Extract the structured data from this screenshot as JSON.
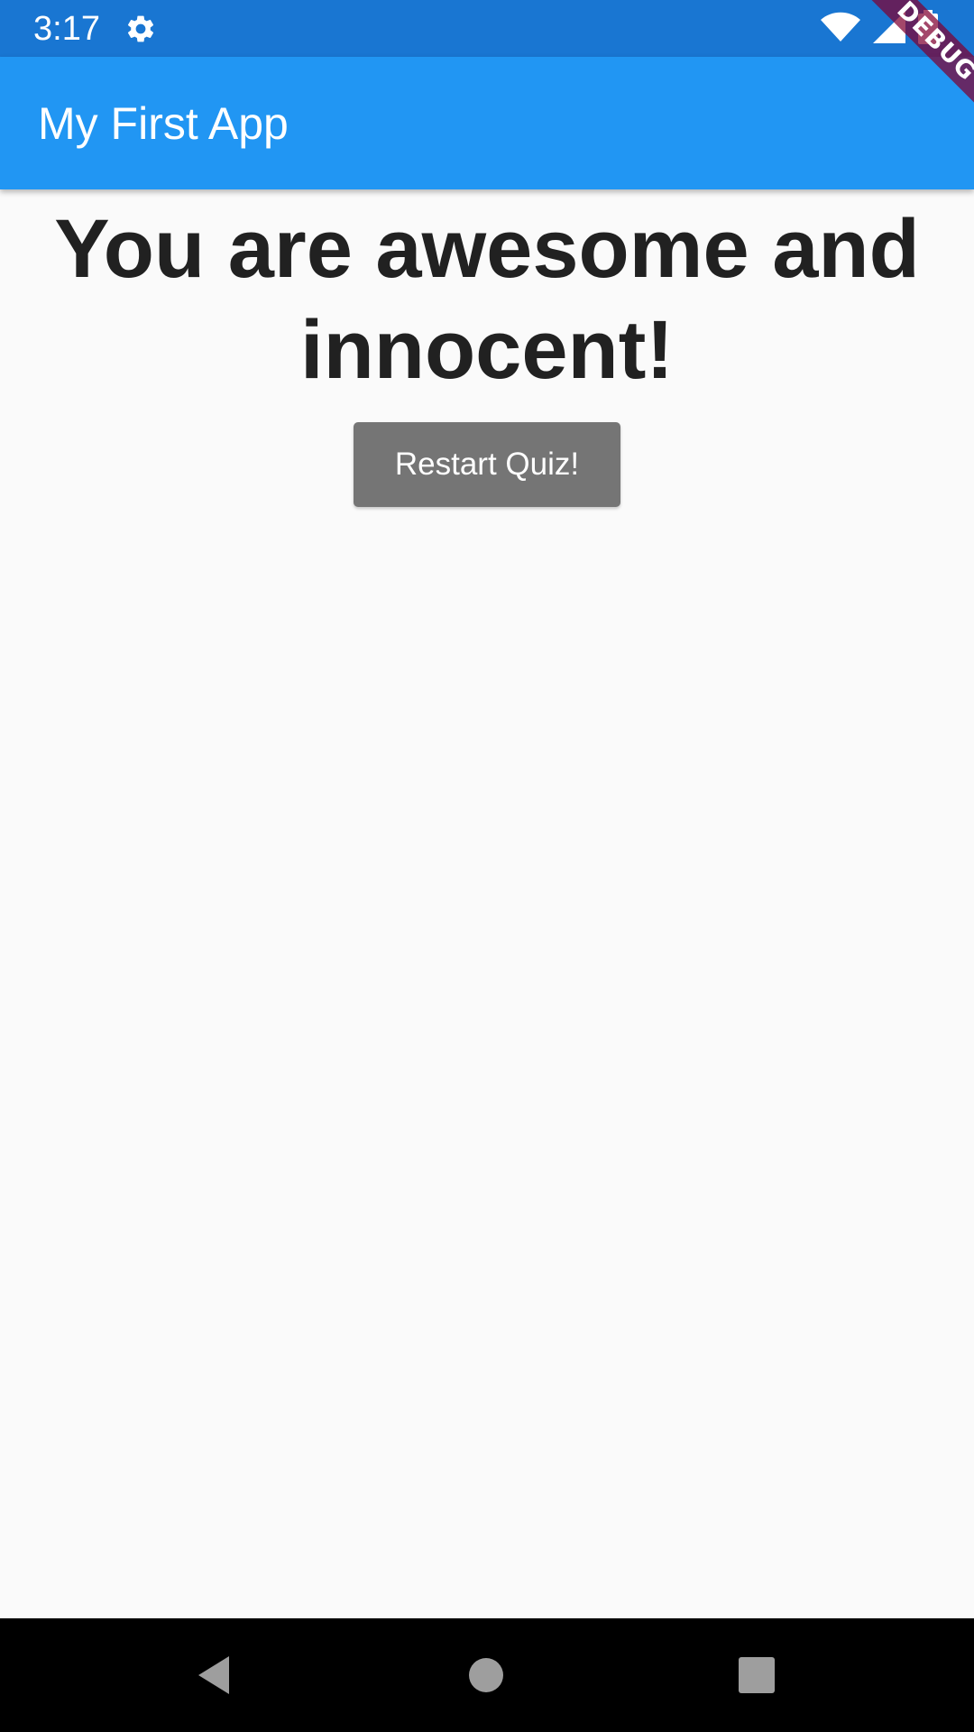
{
  "status_bar": {
    "time": "3:17",
    "icons": [
      "gear-icon",
      "wifi-icon",
      "signal-icon",
      "battery-icon"
    ]
  },
  "debug_banner": {
    "label": "DEBUG"
  },
  "app_bar": {
    "title": "My First App",
    "color": "#2196f3"
  },
  "main": {
    "result_text": "You are awesome and innocent!",
    "restart_button_label": "Restart Quiz!"
  },
  "nav_bar": {
    "buttons": [
      "back-icon",
      "home-icon",
      "recents-icon"
    ]
  },
  "colors": {
    "status_bar": "#1976d2",
    "app_bar": "#2196f3",
    "button": "#757575",
    "background": "#fafafa",
    "text": "#212121"
  }
}
